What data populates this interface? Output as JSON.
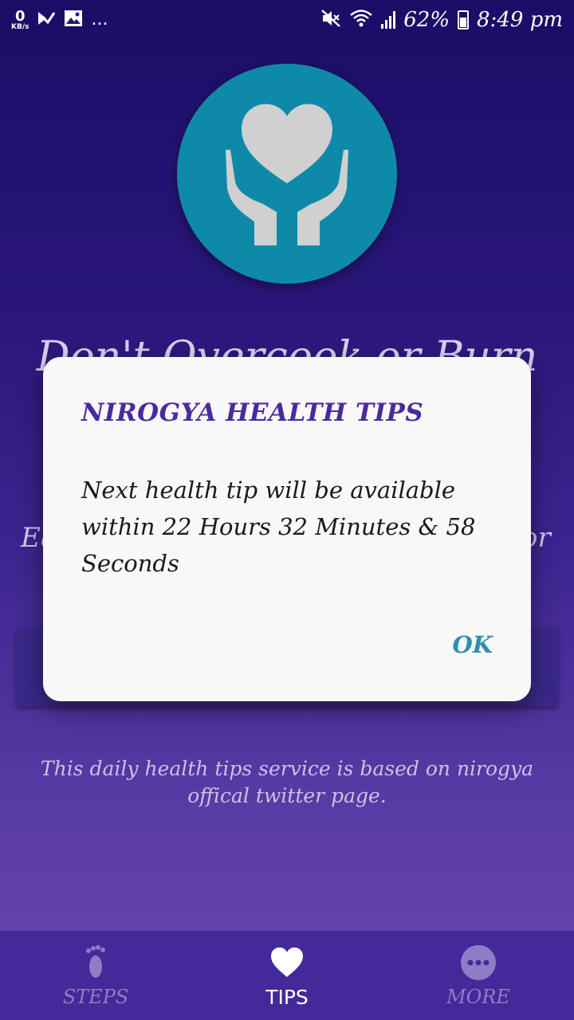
{
  "status_bar": {
    "speed_value": "0",
    "speed_unit": "KB/s",
    "more": "...",
    "battery": "62%",
    "time": "8:49 pm"
  },
  "background": {
    "title": "Don't Overcook or Burn",
    "text_left": "Ea",
    "text_right": "or",
    "note": "This daily health tips service is based on nirogya offical twitter page."
  },
  "dialog": {
    "title": "NIROGYA HEALTH TIPS",
    "message": "Next health tip will be available within 22 Hours 32 Minutes & 58 Seconds",
    "ok_label": "OK"
  },
  "bottom_nav": {
    "items": [
      {
        "label": "STEPS",
        "icon": "footprint-icon",
        "active": false
      },
      {
        "label": "TIPS",
        "icon": "heart-icon",
        "active": true
      },
      {
        "label": "MORE",
        "icon": "more-dots-icon",
        "active": false
      }
    ]
  },
  "colors": {
    "accent": "#4a2aa0",
    "ok_button": "#2e8fb0",
    "logo_circle": "#0e8aa8"
  }
}
